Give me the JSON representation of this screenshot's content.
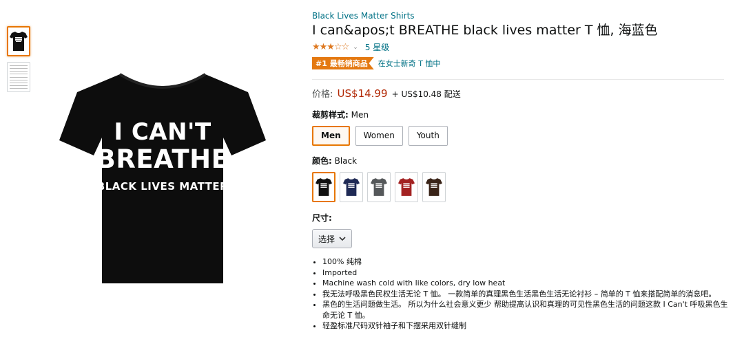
{
  "product": {
    "brand": "Black Lives Matter Shirts",
    "title": "I can&apos;t BREATHE black lives matter T 恤, 海蓝色",
    "rating_stars": "★★★☆☆",
    "rating_value": 3.5,
    "rating_link": "5 星级",
    "badge": "#1 最畅销商品",
    "category_link": "在女士新奇 T 恤中"
  },
  "shirt_print": {
    "line1": "I CAN'T",
    "line2": "BREATHE",
    "line3": "BLACK LIVES MATTER"
  },
  "price": {
    "label": "价格:",
    "value": "US$14.99",
    "shipping": "+ US$10.48 配送"
  },
  "fit": {
    "label": "裁剪样式:",
    "selected": "Men",
    "options": [
      "Men",
      "Women",
      "Youth"
    ]
  },
  "color": {
    "label": "颜色:",
    "selected": "Black",
    "swatches": [
      "#111111",
      "#1f2a55",
      "#55585a",
      "#a32222",
      "#3a2418"
    ]
  },
  "size": {
    "label": "尺寸:",
    "select": "选择"
  },
  "bullets": [
    "100% 纯棉",
    "Imported",
    "Machine wash cold with like colors, dry low heat",
    "我无法呼吸黑色民权生活无论 T 恤。 一款简单的真理黑色生活黑色生活无论衬衫 – 简单的 T 恤来搭配简单的消息吧。",
    "黑色的生活问题做生活。 所以为什么社会意义更少 帮助提高认识和真理的可见性黑色生活的问题这款 I Can't 呼吸黑色生命无论 T 恤。",
    "轻盈标准尺码双针袖子和下摆采用双针缝制"
  ],
  "colors": {
    "link": "#007185",
    "price": "#b12704",
    "accent": "#e77600",
    "star": "#de7921"
  }
}
